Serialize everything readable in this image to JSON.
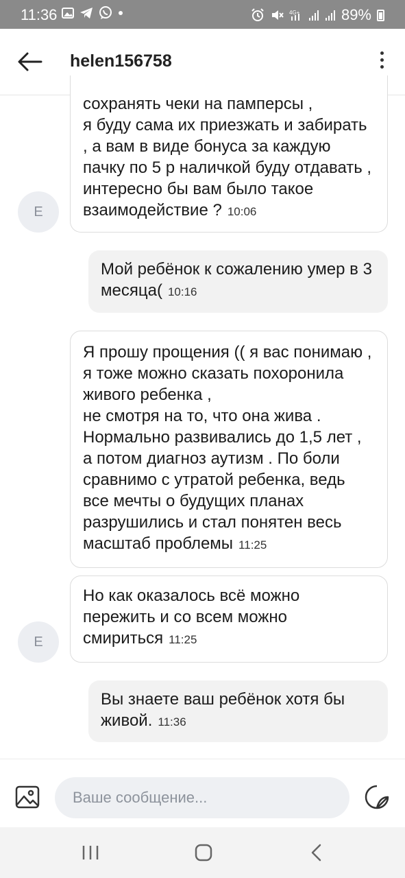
{
  "status_bar": {
    "time": "11:36",
    "battery": "89%"
  },
  "header": {
    "title": "helen156758"
  },
  "messages": [
    {
      "direction": "incoming",
      "avatar_letter": "E",
      "text": "сохранять чеки на памперсы ,\nя буду сама их приезжать и забирать , а вам в виде бонуса за каждую пачку по 5 р наличкой буду отдавать , интересно бы вам было такое взаимодействие ?",
      "time": "10:06"
    },
    {
      "direction": "outgoing",
      "text": "Мой ребёнок к сожалению умер в 3 месяца(",
      "time": "10:16"
    },
    {
      "direction": "incoming",
      "text": "Я прошу прощения (( я вас понимаю , я тоже можно сказать похоронила живого ребенка ,\nне смотря на то, что она жива . Нормально развивались до 1,5 лет , а потом диагноз аутизм .  По боли сравнимо с утратой ребенка, ведь все мечты о будущих планах разрушились и стал понятен весь масштаб проблемы",
      "time": "11:25"
    },
    {
      "direction": "incoming",
      "avatar_letter": "E",
      "text": "Но как оказалось всё можно пережить и со всем можно смириться",
      "time": "11:25"
    },
    {
      "direction": "outgoing",
      "text": "Вы знаете ваш ребёнок хотя бы живой.",
      "time": "11:36"
    }
  ],
  "composer": {
    "placeholder": "Ваше сообщение..."
  },
  "colors": {
    "status_bar_bg": "#8a8a8a",
    "incoming_bubble_bg": "#ffffff",
    "outgoing_bubble_bg": "#f2f2f2",
    "input_bg": "#eef0f3"
  }
}
